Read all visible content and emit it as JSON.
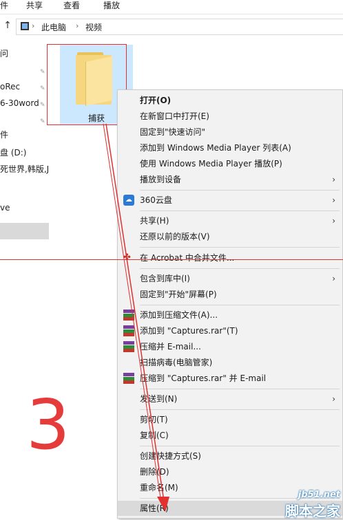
{
  "ribbon": {
    "tabs": [
      "件",
      "共享",
      "查看",
      "播放"
    ]
  },
  "address": {
    "up_icon": "arrow-up-icon",
    "crumbs": [
      "此电脑",
      "视频"
    ]
  },
  "nav": {
    "items": [
      "问",
      "oRec",
      "6-30word",
      "件",
      "盘 (D:)",
      "死世界,韩版,Ju",
      "ve"
    ]
  },
  "folder": {
    "name": "捕获"
  },
  "context_menu": {
    "items": [
      {
        "label": "打开(O)",
        "bold": true
      },
      {
        "label": "在新窗口中打开(E)"
      },
      {
        "label": "固定到\"快速访问\""
      },
      {
        "label": "添加到 Windows Media Player 列表(A)"
      },
      {
        "label": "使用 Windows Media Player 播放(P)"
      },
      {
        "label": "播放到设备",
        "submenu": true
      },
      {
        "label": "360云盘",
        "submenu": true,
        "icon": "cloud-icon"
      },
      {
        "label": "共享(H)",
        "submenu": true
      },
      {
        "label": "还原以前的版本(V)"
      },
      {
        "label": "在 Acrobat 中合并文件...",
        "icon": "acrobat-icon"
      },
      {
        "label": "包含到库中(I)",
        "submenu": true
      },
      {
        "label": "固定到\"开始\"屏幕(P)"
      },
      {
        "label": "添加到压缩文件(A)...",
        "icon": "winrar-icon"
      },
      {
        "label": "添加到 \"Captures.rar\"(T)",
        "icon": "winrar-icon"
      },
      {
        "label": "压缩并 E-mail...",
        "icon": "winrar-icon"
      },
      {
        "label": "扫描病毒(电脑管家)"
      },
      {
        "label": "压缩到 \"Captures.rar\" 并 E-mail",
        "icon": "winrar-icon"
      },
      {
        "label": "发送到(N)",
        "submenu": true
      },
      {
        "label": "剪切(T)"
      },
      {
        "label": "复制(C)"
      },
      {
        "label": "创建快捷方式(S)"
      },
      {
        "label": "删除(D)"
      },
      {
        "label": "重命名(M)"
      },
      {
        "label": "属性(R)",
        "highlighted": true
      }
    ],
    "submenu_glyph": "›"
  },
  "annotation": {
    "step_number": "3"
  },
  "watermark": {
    "line1": "jb51.net",
    "line2": "脚本之家"
  },
  "colors": {
    "annotation_red": "#e03030",
    "selection_blue": "#cce8ff",
    "menu_bg": "#f2f2f2"
  }
}
